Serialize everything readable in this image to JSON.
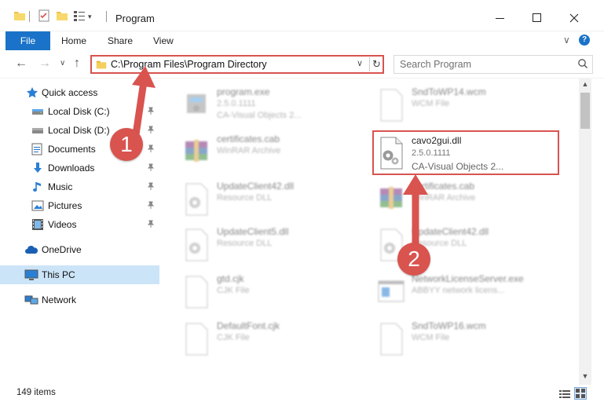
{
  "window": {
    "title": "Program",
    "minimize_label": "–",
    "maximize_label": "☐",
    "close_label": "✕"
  },
  "ribbon": {
    "tabs": [
      {
        "label": "File"
      },
      {
        "label": "Home"
      },
      {
        "label": "Share"
      },
      {
        "label": "View"
      }
    ],
    "expand_glyph": "∨",
    "help_glyph": "?"
  },
  "nav": {
    "back_glyph": "←",
    "forward_glyph": "→",
    "recent_glyph": "∨",
    "up_glyph": "↑",
    "address_path": "C:\\Program Files\\Program Directory",
    "address_dropdown_glyph": "∨",
    "refresh_glyph": "↻",
    "search_placeholder": "Search Program"
  },
  "sidebar": {
    "items": [
      {
        "label": "Quick access",
        "icon": "star-icon",
        "pinned": false
      },
      {
        "label": "Local Disk (C:)",
        "icon": "drive-icon",
        "pinned": true
      },
      {
        "label": "Local Disk (D:)",
        "icon": "drive-icon",
        "pinned": true
      },
      {
        "label": "Documents",
        "icon": "documents-icon",
        "pinned": true
      },
      {
        "label": "Downloads",
        "icon": "download-icon",
        "pinned": true
      },
      {
        "label": "Music",
        "icon": "music-icon",
        "pinned": true
      },
      {
        "label": "Pictures",
        "icon": "pictures-icon",
        "pinned": true
      },
      {
        "label": "Videos",
        "icon": "videos-icon",
        "pinned": true
      },
      {
        "label": "OneDrive",
        "icon": "cloud-icon",
        "pinned": false
      },
      {
        "label": "This PC",
        "icon": "pc-icon",
        "pinned": false,
        "selected": true
      },
      {
        "label": "Network",
        "icon": "network-icon",
        "pinned": false
      }
    ],
    "pin_glyph": "📌"
  },
  "files": [
    {
      "name": "program.exe",
      "line2": "2.5.0.1111",
      "line3": "CA-Visual Objects 2...",
      "icon": "exe-icon"
    },
    {
      "name": "SndToWP14.wcm",
      "line2": "WCM File",
      "line3": "",
      "icon": "file-icon"
    },
    {
      "name": "certificates.cab",
      "line2": "WinRAR Archive",
      "line3": "",
      "icon": "archive-icon"
    },
    {
      "name": "cavo2gui.dll",
      "line2": "2.5.0.1111",
      "line3": "CA-Visual Objects 2...",
      "icon": "dll-gear-icon"
    },
    {
      "name": "UpdateClient42.dll",
      "line2": "Resource DLL",
      "line3": "",
      "icon": "dll-gear-icon"
    },
    {
      "name": "certificates.cab",
      "line2": "WinRAR Archive",
      "line3": "",
      "icon": "archive-icon"
    },
    {
      "name": "UpdateClient5.dll",
      "line2": "Resource DLL",
      "line3": "",
      "icon": "dll-gear-icon"
    },
    {
      "name": "UpdateClient42.dll",
      "line2": "Resource DLL",
      "line3": "",
      "icon": "dll-gear-icon"
    },
    {
      "name": "gtd.cjk",
      "line2": "CJK File",
      "line3": "",
      "icon": "file-icon"
    },
    {
      "name": "NetworkLicenseServer.exe",
      "line2": "ABBYY network licens...",
      "line3": "",
      "icon": "window-icon"
    },
    {
      "name": "DefaultFont.cjk",
      "line2": "CJK File",
      "line3": "",
      "icon": "file-icon"
    },
    {
      "name": "SndToWP16.wcm",
      "line2": "WCM File",
      "line3": "",
      "icon": "file-icon"
    }
  ],
  "status": {
    "item_count": "149 items"
  },
  "annotations": {
    "badge1": "1",
    "badge2": "2"
  },
  "colors": {
    "accent": "#1a73c8",
    "highlight_red": "#d9534f",
    "selection": "#cce4f7"
  }
}
